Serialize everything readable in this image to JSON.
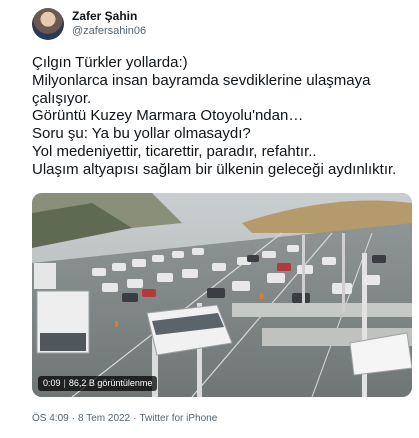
{
  "tweet": {
    "author": {
      "display_name": "Zafer Şahin",
      "handle": "@zafersahin06"
    },
    "lines": [
      "Çılgın Türkler yollarda:)",
      "Milyonlarca insan bayramda sevdiklerine ulaşmaya",
      "çalışıyor.",
      "Görüntü Kuzey Marmara Otoyolu'ndan…",
      "Soru şu: Ya bu yollar olmasaydı?",
      "Yol medeniyettir, ticarettir, paradır, refahtır..",
      "Ulaşım altyapısı sağlam bir ülkenin geleceği aydınlıktır."
    ],
    "video": {
      "duration": "0:09",
      "views": "86,2 B görüntülenme"
    },
    "time": "ÖS 4:09",
    "date": "8 Tem 2022",
    "source": "Twitter for iPhone",
    "icons": {
      "avatar": "avatar-photo",
      "media": "video-thumbnail"
    }
  }
}
